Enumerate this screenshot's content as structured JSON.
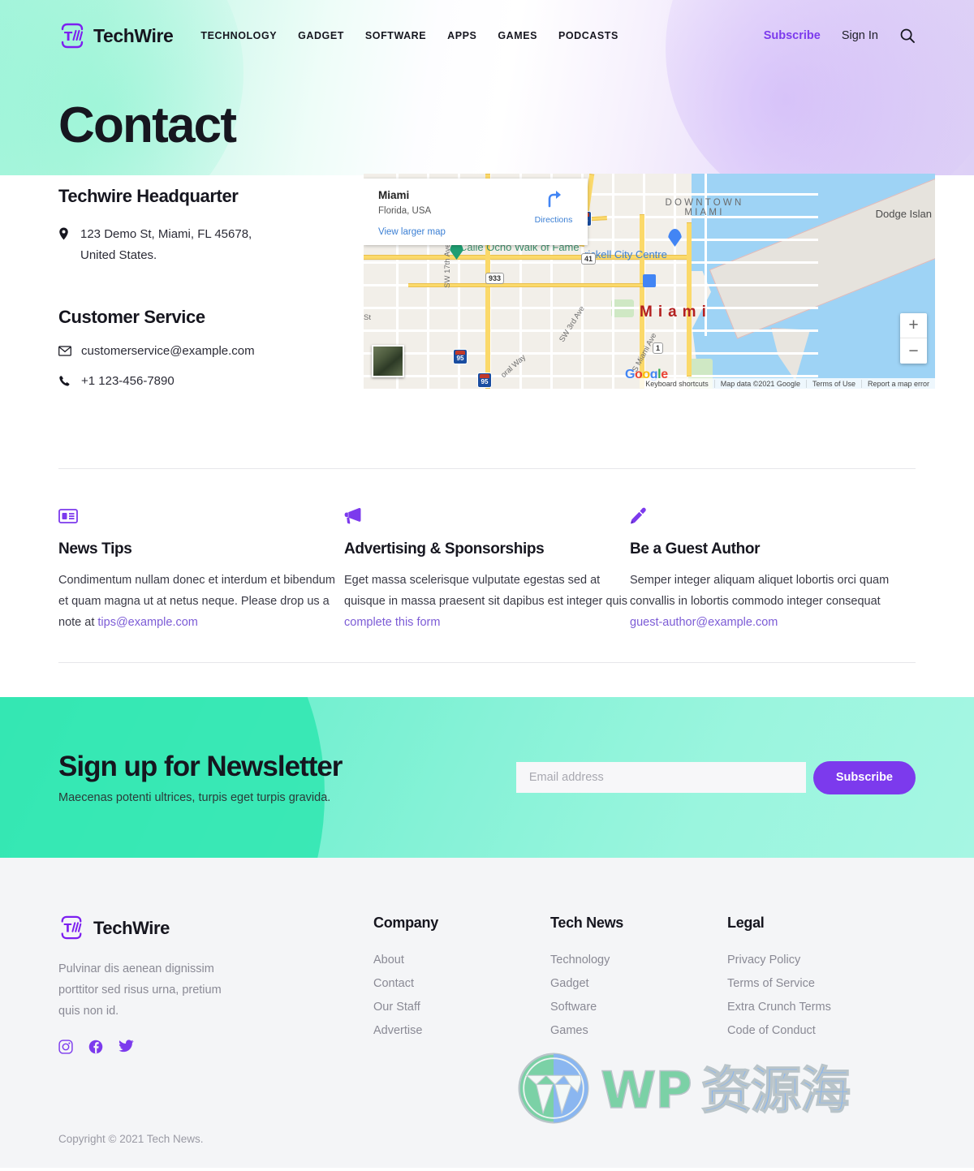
{
  "header": {
    "logo_name": "techwire-logo",
    "brand": "TechWire",
    "nav": [
      {
        "label": "TECHNOLOGY",
        "name": "nav-link-technology"
      },
      {
        "label": "GADGET",
        "name": "nav-link-gadget"
      },
      {
        "label": "SOFTWARE",
        "name": "nav-link-software"
      },
      {
        "label": "APPS",
        "name": "nav-link-apps"
      },
      {
        "label": "GAMES",
        "name": "nav-link-games"
      },
      {
        "label": "PODCASTS",
        "name": "nav-link-podcasts"
      }
    ],
    "subscribe": "Subscribe",
    "sign_in": "Sign In",
    "search_icon": "search-icon"
  },
  "page": {
    "title": "Contact"
  },
  "contact": {
    "hq_title": "Techwire Headquarter",
    "address_icon": "location-pin-icon",
    "address_line1": "123 Demo St, Miami, FL 45678,",
    "address_line2": "United States.",
    "cs_title": "Customer Service",
    "email_icon": "envelope-icon",
    "email": "customerservice@example.com",
    "phone_icon": "phone-icon",
    "phone": "+1 123-456-7890"
  },
  "map": {
    "card_title": "Miami",
    "card_subtitle": "Florida, USA",
    "view_larger": "View larger map",
    "directions": "Directions",
    "directions_icon": "directions-arrow-icon",
    "zoom_in": "+",
    "zoom_out": "−",
    "labels": {
      "downtown_line1": "DOWNTOWN",
      "downtown_line2": "MIAMI",
      "dodge_island": "Dodge Islan",
      "brickell": "rickell City Centre",
      "calle_ocho": "Calle Ocho Walk of Fame",
      "miami_big": "Miami",
      "sw17": "SW 17th Ave",
      "sw3": "SW 3rd Ave",
      "coral": "oral Way",
      "miami_ave": "S Miami Ave",
      "st": "St",
      "route_933": "933",
      "route_41": "41",
      "route_1": "1",
      "route_95a": "95",
      "route_95b": "95",
      "route_95c": "95"
    },
    "google_logo": "Google",
    "footer": [
      "Keyboard shortcuts",
      "Map data ©2021 Google",
      "Terms of Use",
      "Report a map error"
    ]
  },
  "features": [
    {
      "icon": "newspaper-icon",
      "title": "News Tips",
      "body_before": "Condimentum nullam donec et interdum et bibendum et quam magna ut at netus neque. Please drop us a note at ",
      "link": "tips@example.com",
      "body_after": ""
    },
    {
      "icon": "megaphone-icon",
      "title": "Advertising & Sponsorships",
      "body_before": "Eget massa scelerisque vulputate egestas sed at quisque in massa praesent sit dapibus est integer quis ",
      "link": "complete this form",
      "body_after": ""
    },
    {
      "icon": "pen-icon",
      "title": "Be a Guest Author",
      "body_before": "Semper integer aliquam aliquet lobortis orci quam convallis in lobortis commodo integer consequat ",
      "link": "guest-author@example.com",
      "body_after": ""
    }
  ],
  "newsletter": {
    "title": "Sign up for Newsletter",
    "subtitle": "Maecenas potenti ultrices, turpis eget turpis gravida.",
    "placeholder": "Email address",
    "input_value": "",
    "button": "Subscribe"
  },
  "footer": {
    "brand": "TechWire",
    "logo_name": "techwire-logo",
    "description": "Pulvinar dis aenean dignissim porttitor sed risus urna, pretium quis non id.",
    "socials": [
      {
        "name": "instagram-icon",
        "label": "Instagram"
      },
      {
        "name": "facebook-icon",
        "label": "Facebook"
      },
      {
        "name": "twitter-icon",
        "label": "Twitter"
      }
    ],
    "columns": [
      {
        "heading": "Company",
        "items": [
          "About",
          "Contact",
          "Our Staff",
          "Advertise"
        ]
      },
      {
        "heading": "Tech News",
        "items": [
          "Technology",
          "Gadget",
          "Software",
          "Games"
        ]
      },
      {
        "heading": "Legal",
        "items": [
          "Privacy Policy",
          "Terms of Service",
          "Extra Crunch Terms",
          "Code of Conduct"
        ]
      }
    ],
    "copyright": "Copyright © 2021 Tech News."
  },
  "watermark": {
    "wp": "WP",
    "cn": "资源海",
    "logo": "wordpress-icon"
  },
  "colors": {
    "accent": "#7c3aed",
    "mint": "#52ebc0",
    "lilac": "#ddd0f6",
    "text": "#16161f",
    "muted": "#8a8a95"
  }
}
